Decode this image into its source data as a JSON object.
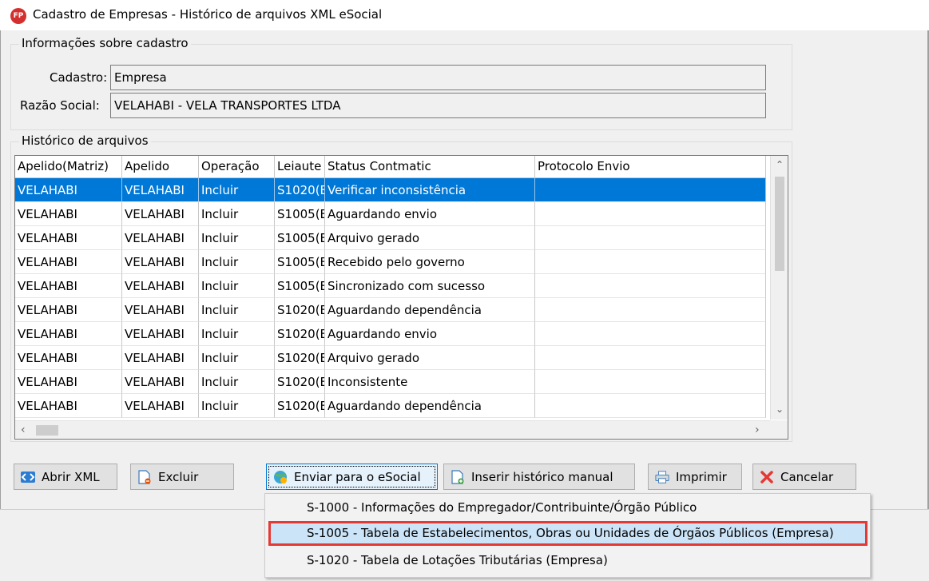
{
  "window": {
    "app_icon_text": "FP",
    "title": "Cadastro de Empresas - Histórico de arquivos XML eSocial"
  },
  "info_group": {
    "legend": "Informações sobre cadastro",
    "cadastro_label": "Cadastro:",
    "cadastro_value": "Empresa",
    "razao_label": "Razão Social:",
    "razao_value": "VELAHABI - VELA TRANSPORTES LTDA"
  },
  "history_group": {
    "legend": "Histórico de arquivos",
    "columns": [
      "Apelido(Matriz)",
      "Apelido",
      "Operação",
      "Leiaute",
      "Status Contmatic",
      "Protocolo Envio"
    ],
    "rows": [
      [
        "VELAHABI",
        "VELAHABI",
        "Incluir",
        "S1020(E",
        "Verificar inconsistência",
        ""
      ],
      [
        "VELAHABI",
        "VELAHABI",
        "Incluir",
        "S1005(E",
        "Aguardando envio",
        ""
      ],
      [
        "VELAHABI",
        "VELAHABI",
        "Incluir",
        "S1005(E",
        "Arquivo gerado",
        ""
      ],
      [
        "VELAHABI",
        "VELAHABI",
        "Incluir",
        "S1005(E",
        "Recebido pelo governo",
        ""
      ],
      [
        "VELAHABI",
        "VELAHABI",
        "Incluir",
        "S1005(E",
        "Sincronizado com sucesso",
        ""
      ],
      [
        "VELAHABI",
        "VELAHABI",
        "Incluir",
        "S1020(E",
        "Aguardando dependência",
        ""
      ],
      [
        "VELAHABI",
        "VELAHABI",
        "Incluir",
        "S1020(E",
        "Aguardando envio",
        ""
      ],
      [
        "VELAHABI",
        "VELAHABI",
        "Incluir",
        "S1020(E",
        "Arquivo gerado",
        ""
      ],
      [
        "VELAHABI",
        "VELAHABI",
        "Incluir",
        "S1020(E",
        "Inconsistente",
        ""
      ],
      [
        "VELAHABI",
        "VELAHABI",
        "Incluir",
        "S1020(E",
        "Aguardando dependência",
        ""
      ]
    ]
  },
  "buttons": {
    "abrir_xml": "Abrir XML",
    "excluir": "Excluir",
    "enviar": "Enviar para o eSocial",
    "inserir": "Inserir histórico manual",
    "imprimir": "Imprimir",
    "cancelar": "Cancelar"
  },
  "menu": {
    "items": [
      "S-1000 - Informações do Empregador/Contribuinte/Órgão Público",
      "S-1005 - Tabela de Estabelecimentos, Obras ou Unidades de Órgãos Públicos (Empresa)",
      "S-1020 - Tabela de Lotações Tributárias (Empresa)"
    ]
  },
  "icons": {
    "abrir_xml": "code-arrows-icon",
    "excluir": "document-delete-icon",
    "enviar": "globe-send-icon",
    "inserir": "document-add-icon",
    "imprimir": "printer-icon",
    "cancelar": "red-x-icon"
  },
  "colors": {
    "selection": "#0078d7",
    "menu_highlight": "#cce4f7",
    "highlight_border": "#e53935",
    "app_icon": "#d32f2f"
  }
}
